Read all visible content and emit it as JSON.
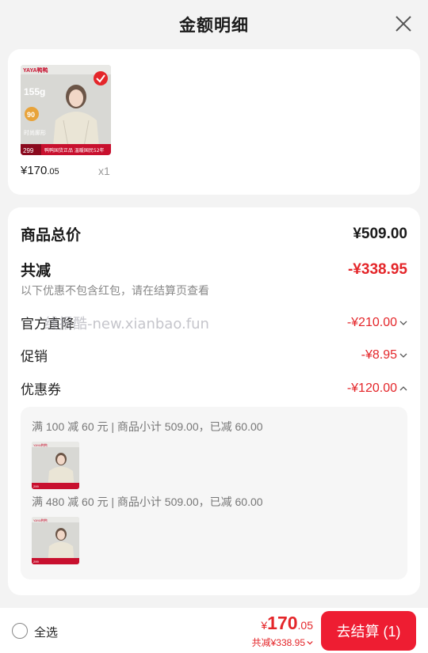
{
  "header": {
    "title": "金额明细"
  },
  "product": {
    "image": {
      "brand": "YAYA鸭鸭",
      "weight": "155g",
      "badge_left": "90",
      "tag": "时尚廓形",
      "price_tag": "299",
      "banner": "鸭鸭国货正品 温暖国民52年"
    },
    "price_int": "¥170",
    "price_dec": ".05",
    "qty": "x1"
  },
  "detail": {
    "total_label": "商品总价",
    "total_value": "¥509.00",
    "reduce_label": "共减",
    "reduce_value": "-¥338.95",
    "note": "以下优惠不包含红包，请在结算页查看",
    "official_label": "官方直降",
    "official_value": "-¥210.00",
    "promo_label": "促销",
    "promo_value": "-¥8.95",
    "coupon_label": "优惠券",
    "coupon_value": "-¥120.00",
    "coupons": [
      {
        "text": "满 100 减 60 元 | 商品小计 509.00，已减 60.00"
      },
      {
        "text": "满 480 减 60 元 | 商品小计 509.00，已减 60.00"
      }
    ]
  },
  "watermark": "线报酷-new.xianbao.fun",
  "footer": {
    "select_all": "全选",
    "currency": "¥",
    "total_int": "170",
    "total_dec": ".05",
    "saved": "共减¥338.95",
    "checkout": "去结算 (1)"
  },
  "colors": {
    "accent": "#ee1d32",
    "price_red": "#e4262a"
  }
}
